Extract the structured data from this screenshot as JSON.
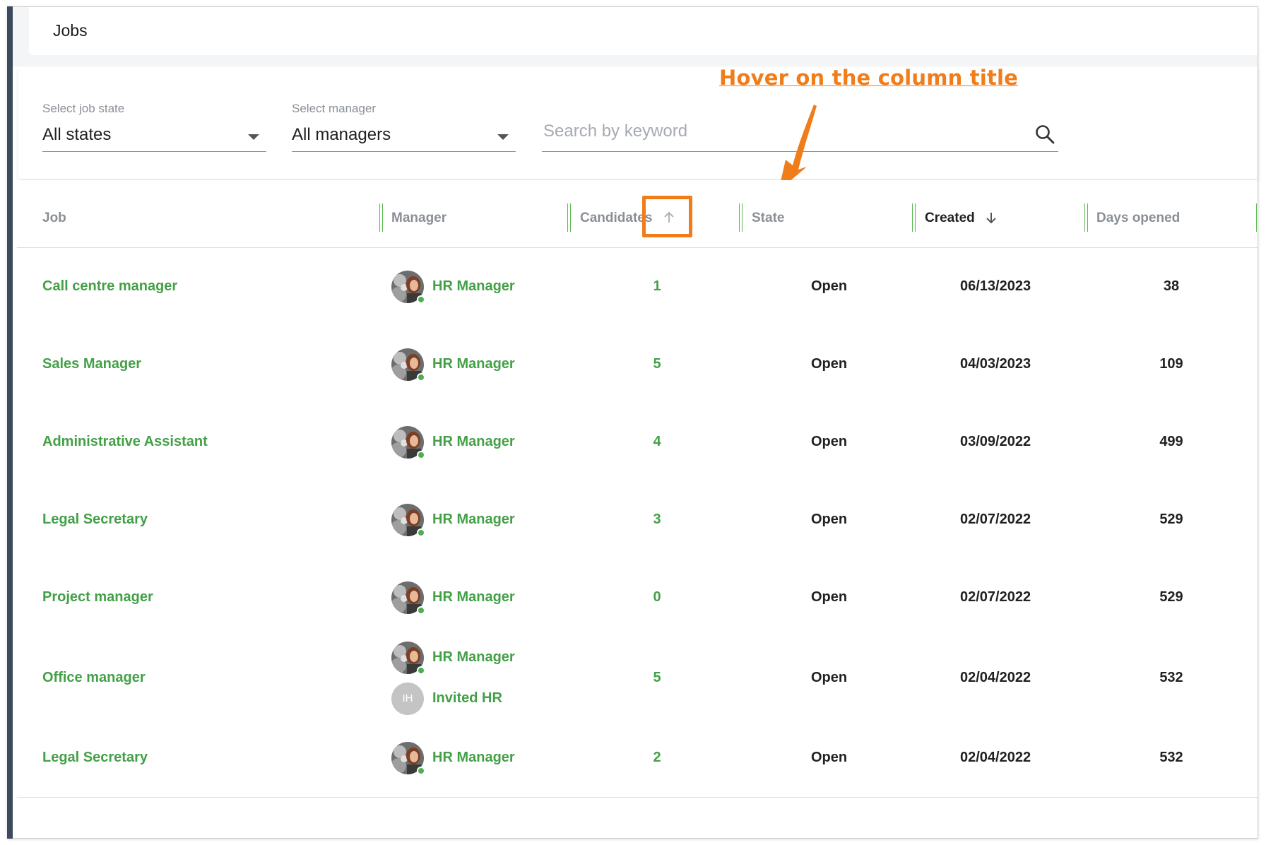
{
  "page": {
    "title": "Jobs"
  },
  "filters": {
    "job_state": {
      "label": "Select job state",
      "value": "All states"
    },
    "manager": {
      "label": "Select manager",
      "value": "All managers"
    },
    "search": {
      "placeholder": "Search by keyword"
    }
  },
  "annotation": {
    "text": "Hover on the column title"
  },
  "table": {
    "columns": [
      "Job",
      "Manager",
      "Candidates",
      "State",
      "Created",
      "Days opened"
    ],
    "sort": {
      "active_column": "Created",
      "direction": "descending",
      "hover_column": "Candidates"
    },
    "rows": [
      {
        "job": "Call centre manager",
        "managers": [
          {
            "name": "HR Manager",
            "avatar": "photo"
          }
        ],
        "candidates": "1",
        "state": "Open",
        "created": "06/13/2023",
        "days_opened": "38"
      },
      {
        "job": "Sales Manager",
        "managers": [
          {
            "name": "HR Manager",
            "avatar": "photo"
          }
        ],
        "candidates": "5",
        "state": "Open",
        "created": "04/03/2023",
        "days_opened": "109"
      },
      {
        "job": "Administrative Assistant",
        "managers": [
          {
            "name": "HR Manager",
            "avatar": "photo"
          }
        ],
        "candidates": "4",
        "state": "Open",
        "created": "03/09/2022",
        "days_opened": "499"
      },
      {
        "job": "Legal Secretary",
        "managers": [
          {
            "name": "HR Manager",
            "avatar": "photo"
          }
        ],
        "candidates": "3",
        "state": "Open",
        "created": "02/07/2022",
        "days_opened": "529"
      },
      {
        "job": "Project manager",
        "managers": [
          {
            "name": "HR Manager",
            "avatar": "photo"
          }
        ],
        "candidates": "0",
        "state": "Open",
        "created": "02/07/2022",
        "days_opened": "529"
      },
      {
        "job": "Office manager",
        "managers": [
          {
            "name": "HR Manager",
            "avatar": "photo"
          },
          {
            "name": "Invited HR",
            "avatar": "initials",
            "initials": "IH"
          }
        ],
        "candidates": "5",
        "state": "Open",
        "created": "02/04/2022",
        "days_opened": "532"
      },
      {
        "job": "Legal Secretary",
        "managers": [
          {
            "name": "HR Manager",
            "avatar": "photo"
          }
        ],
        "candidates": "2",
        "state": "Open",
        "created": "02/04/2022",
        "days_opened": "532"
      }
    ]
  },
  "colors": {
    "accent_green": "#43a047",
    "annotation_orange": "#f07c1a",
    "rail": "#3c4a5c"
  }
}
